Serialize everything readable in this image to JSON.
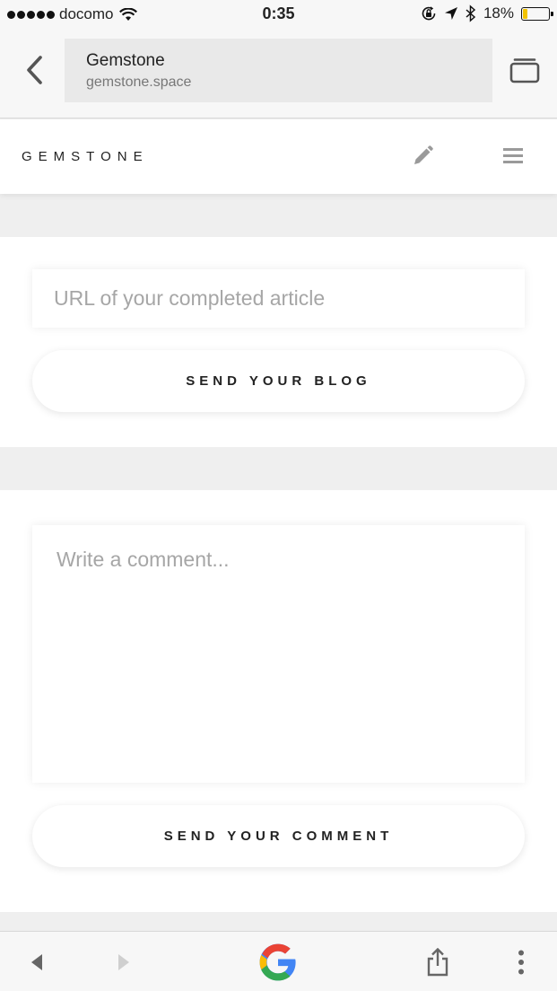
{
  "status_bar": {
    "carrier": "docomo",
    "time": "0:35",
    "battery_percent": "18%",
    "battery_level": 0.18
  },
  "browser": {
    "page_title": "Gemstone",
    "domain": "gemstone.space"
  },
  "site": {
    "logo": "GEMSTONE"
  },
  "blog_form": {
    "url_placeholder": "URL of your completed article",
    "send_label": "SEND YOUR BLOG"
  },
  "comment_form": {
    "comment_placeholder": "Write a comment...",
    "send_label": "SEND YOUR COMMENT"
  },
  "icons": {
    "back": "chevron-left-icon",
    "tabs": "tabs-icon",
    "edit": "pencil-icon",
    "menu": "hamburger-menu-icon",
    "nav_back": "triangle-left-icon",
    "nav_forward": "triangle-right-icon",
    "google": "google-logo-icon",
    "share": "share-icon",
    "more": "more-vertical-icon"
  },
  "colors": {
    "battery": "#f2c300",
    "placeholder": "#a6a6a6",
    "google_blue": "#4285F4",
    "google_red": "#EA4335",
    "google_yellow": "#FBBC05",
    "google_green": "#34A853"
  }
}
